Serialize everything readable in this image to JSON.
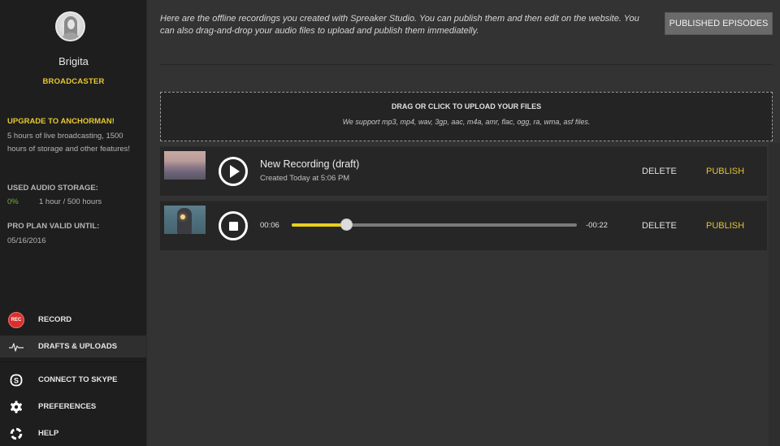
{
  "sidebar": {
    "user": {
      "name": "Brigita",
      "role": "BROADCASTER"
    },
    "upgrade": {
      "title": "UPGRADE TO ANCHORMAN!",
      "text": "5 hours of live broadcasting, 1500 hours of storage and other features!"
    },
    "storage": {
      "title": "USED AUDIO STORAGE:",
      "percent": "0%",
      "value": "1 hour / 500 hours"
    },
    "plan": {
      "title": "PRO PLAN VALID UNTIL:",
      "date": "05/16/2016"
    },
    "nav": [
      {
        "label": "RECORD",
        "icon": "rec-icon",
        "badge": "REC",
        "active": false
      },
      {
        "label": "DRAFTS & UPLOADS",
        "icon": "waveform-icon",
        "active": true
      },
      {
        "label": "CONNECT TO SKYPE",
        "icon": "skype-icon",
        "active": false
      },
      {
        "label": "PREFERENCES",
        "icon": "gear-icon",
        "active": false
      },
      {
        "label": "HELP",
        "icon": "lifebuoy-icon",
        "active": false
      }
    ]
  },
  "main": {
    "intro": "Here are the offline recordings you created with Spreaker Studio. You can publish them and then edit on the website. You can also drag-and-drop your audio files to upload and publish them immediatelly.",
    "published_button": "PUBLISHED EPISODES",
    "dropzone": {
      "title": "DRAG OR CLICK TO UPLOAD YOUR FILES",
      "subtitle": "We support mp3, mp4, wav, 3gp, aac, m4a, amr, flac, ogg, ra, wma, asf files."
    },
    "recordings": [
      {
        "title": "New Recording (draft)",
        "meta": "Created Today at 5:06 PM",
        "state": "paused",
        "delete_label": "DELETE",
        "publish_label": "PUBLISH"
      },
      {
        "state": "playing",
        "elapsed": "00:06",
        "remaining": "-00:22",
        "progress": 0.19,
        "delete_label": "DELETE",
        "publish_label": "PUBLISH"
      }
    ]
  },
  "colors": {
    "accent_yellow": "#e8c82f",
    "storage_green": "#6fae3a",
    "rec_red": "#d9302e",
    "sidebar_bg": "#1e1e1e",
    "main_bg": "#333333",
    "row_bg": "#262626"
  }
}
